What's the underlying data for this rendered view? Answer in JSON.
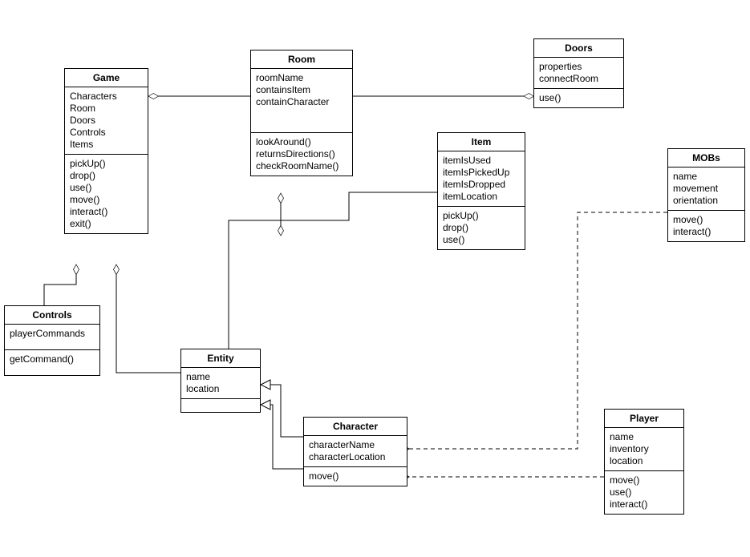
{
  "chart_data": {
    "type": "uml_class_diagram",
    "classes": [
      {
        "id": "game",
        "name": "Game",
        "attributes": [
          "Characters",
          "Room",
          "Doors",
          "Controls",
          "Items"
        ],
        "methods": [
          "pickUp()",
          "drop()",
          "use()",
          "move()",
          "interact()",
          "exit()"
        ]
      },
      {
        "id": "room",
        "name": "Room",
        "attributes": [
          "roomName",
          "containsItem",
          "containCharacter"
        ],
        "methods": [
          "lookAround()",
          "returnsDirections()",
          "checkRoomName()"
        ]
      },
      {
        "id": "doors",
        "name": "Doors",
        "attributes": [
          "properties",
          "connectRoom"
        ],
        "methods": [
          "use()"
        ]
      },
      {
        "id": "item",
        "name": "Item",
        "attributes": [
          "itemIsUsed",
          "itemIsPickedUp",
          "itemIsDropped",
          "itemLocation"
        ],
        "methods": [
          "pickUp()",
          "drop()",
          "use()"
        ]
      },
      {
        "id": "mobs",
        "name": "MOBs",
        "attributes": [
          "name",
          "movement",
          "orientation"
        ],
        "methods": [
          "move()",
          "interact()"
        ]
      },
      {
        "id": "controls",
        "name": "Controls",
        "attributes": [
          "playerCommands"
        ],
        "methods": [
          "getCommand()"
        ]
      },
      {
        "id": "entity",
        "name": "Entity",
        "attributes": [
          "name",
          "location"
        ],
        "methods": []
      },
      {
        "id": "character",
        "name": "Character",
        "attributes": [
          "characterName",
          "characterLocation"
        ],
        "methods": [
          "move()"
        ]
      },
      {
        "id": "player",
        "name": "Player",
        "attributes": [
          "name",
          "inventory",
          "location"
        ],
        "methods": [
          "move()",
          "use()",
          "interact()"
        ]
      }
    ],
    "relations": [
      {
        "from": "game",
        "to": "room",
        "type": "aggregation",
        "diamond_at": "game"
      },
      {
        "from": "game",
        "to": "controls",
        "type": "aggregation",
        "diamond_at": "game"
      },
      {
        "from": "game",
        "to": "entity",
        "type": "aggregation",
        "diamond_at": "game"
      },
      {
        "from": "room",
        "to": "doors",
        "type": "aggregation",
        "diamond_at": "doors"
      },
      {
        "from": "room",
        "to": "item",
        "type": "aggregation",
        "diamond_at": "room"
      },
      {
        "from": "room",
        "to": "entity",
        "type": "aggregation",
        "diamond_at": "room"
      },
      {
        "from": "entity",
        "to": "character",
        "type": "generalization",
        "arrow_at": "entity"
      },
      {
        "from": "player",
        "to": "character",
        "type": "dependency",
        "arrow_at": "character"
      },
      {
        "from": "mobs",
        "to": "character",
        "type": "dependency",
        "arrow_at": "character"
      }
    ]
  },
  "classes": {
    "game": {
      "name": "Game",
      "attrs": "Characters\nRoom\nDoors\nControls\nItems",
      "ops": "pickUp()\ndrop()\nuse()\nmove()\ninteract()\nexit()"
    },
    "room": {
      "name": "Room",
      "attrs": "roomName\ncontainsItem\ncontainCharacter",
      "ops": "lookAround()\nreturnsDirections()\ncheckRoomName()"
    },
    "doors": {
      "name": "Doors",
      "attrs": "properties\nconnectRoom",
      "ops": "use()"
    },
    "item": {
      "name": "Item",
      "attrs": "itemIsUsed\nitemIsPickedUp\nitemIsDropped\nitemLocation",
      "ops": "pickUp()\ndrop()\nuse()"
    },
    "mobs": {
      "name": "MOBs",
      "attrs": "name\nmovement\norientation",
      "ops": "move()\ninteract()"
    },
    "controls": {
      "name": "Controls",
      "attrs": "playerCommands",
      "ops": "getCommand()"
    },
    "entity": {
      "name": "Entity",
      "attrs": "name\nlocation",
      "ops": ""
    },
    "character": {
      "name": "Character",
      "attrs": "characterName\ncharacterLocation",
      "ops": "move()"
    },
    "player": {
      "name": "Player",
      "attrs": "name\ninventory\nlocation",
      "ops": "move()\nuse()\ninteract()"
    }
  }
}
